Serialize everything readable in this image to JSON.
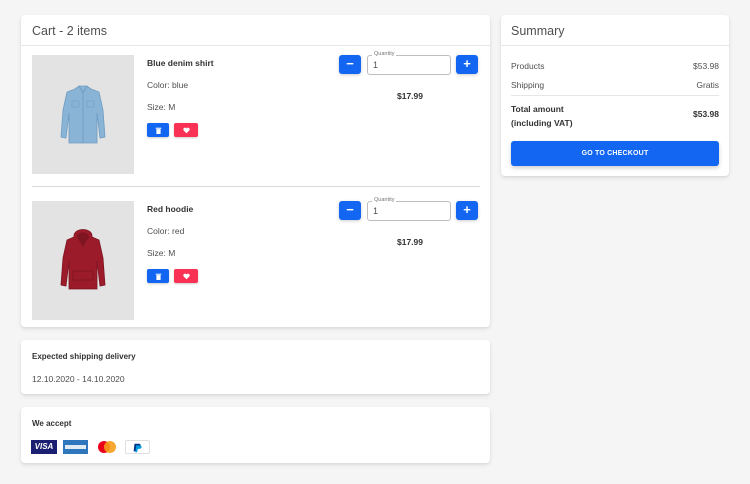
{
  "cart": {
    "title": "Cart - 2 items",
    "items": [
      {
        "name": "Blue denim shirt",
        "color": "Color: blue",
        "size": "Size: M",
        "quantity_label": "Quantity",
        "quantity": "1",
        "price": "$17.99",
        "image_icon": "denim-shirt-icon"
      },
      {
        "name": "Red hoodie",
        "color": "Color: red",
        "size": "Size: M",
        "quantity_label": "Quantity",
        "quantity": "1",
        "price": "$17.99",
        "image_icon": "red-hoodie-icon"
      }
    ],
    "minus_label": "−",
    "plus_label": "+"
  },
  "shipping": {
    "title": "Expected shipping delivery",
    "dates": "12.10.2020 - 14.10.2020"
  },
  "accept": {
    "title": "We accept",
    "methods": [
      "visa-icon",
      "amex-icon",
      "mastercard-icon",
      "paypal-icon"
    ],
    "visa_text": "VISA"
  },
  "summary": {
    "title": "Summary",
    "products_label": "Products",
    "products_value": "$53.98",
    "shipping_label": "Shipping",
    "shipping_value": "Gratis",
    "total_label_line1": "Total amount",
    "total_label_line2": "(including VAT)",
    "total_value": "$53.98",
    "checkout_label": "GO TO CHECKOUT"
  },
  "colors": {
    "primary": "#1266f1",
    "danger": "#f93154",
    "background": "#f5f5f5"
  }
}
